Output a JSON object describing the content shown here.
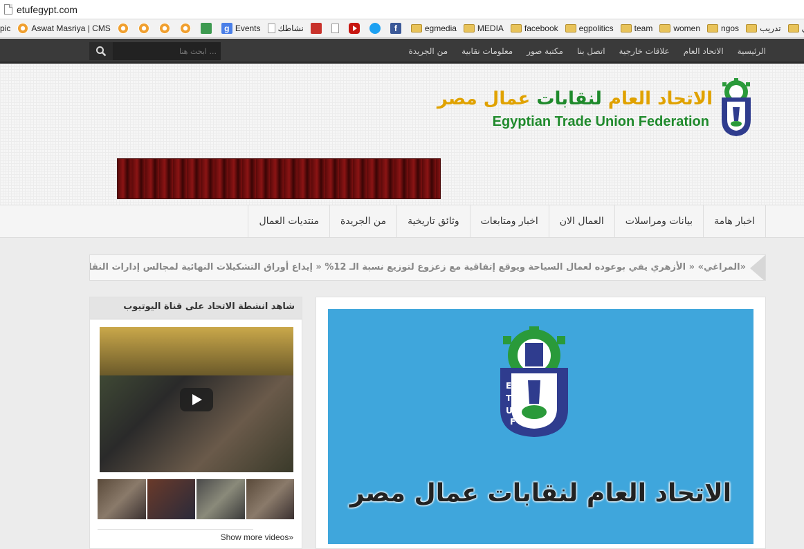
{
  "browser": {
    "url": "etufegypt.com",
    "bookmarks": [
      {
        "label": "pic",
        "icon": "none"
      },
      {
        "label": "Aswat Masriya | CMS",
        "icon": "orange-icon"
      },
      {
        "label": "",
        "icon": "orange-icon"
      },
      {
        "label": "",
        "icon": "orange-icon"
      },
      {
        "label": "",
        "icon": "orange-icon"
      },
      {
        "label": "",
        "icon": "orange-icon"
      },
      {
        "label": "",
        "icon": "tree-icon"
      },
      {
        "label": "Events",
        "icon": "google-icon"
      },
      {
        "label": "نشاطك",
        "icon": "page-icon"
      },
      {
        "label": "",
        "icon": "red-icon"
      },
      {
        "label": "",
        "icon": "page-icon"
      },
      {
        "label": "",
        "icon": "youtube-icon"
      },
      {
        "label": "",
        "icon": "twitter-icon"
      },
      {
        "label": "",
        "icon": "facebook-icon"
      },
      {
        "label": "egmedia",
        "icon": "folder-icon"
      },
      {
        "label": "MEDIA",
        "icon": "folder-icon"
      },
      {
        "label": "facebook",
        "icon": "folder-icon"
      },
      {
        "label": "egpolitics",
        "icon": "folder-icon"
      },
      {
        "label": "team",
        "icon": "folder-icon"
      },
      {
        "label": "women",
        "icon": "folder-icon"
      },
      {
        "label": "ngos",
        "icon": "folder-icon"
      },
      {
        "label": "تدريب",
        "icon": "folder-icon"
      },
      {
        "label": "ثقافي",
        "icon": "folder-icon"
      }
    ]
  },
  "topnav": {
    "links": [
      "الرئيسية",
      "الاتحاد العام",
      "علاقات خارجية",
      "اتصل بنا",
      "مكتبة صور",
      "معلومات نقابية",
      "من الجريدة"
    ],
    "search_placeholder": "ابحث هنا ..."
  },
  "header": {
    "logo_ar_part1": "الاتحاد العام ",
    "logo_ar_part2": "لنقابات",
    "logo_ar_part3": " عمال مصر",
    "logo_en": "Egyptian Trade Union Federation"
  },
  "mainnav": {
    "items": [
      "اخبار هامة",
      "بيانات ومراسلات",
      "العمال الان",
      "اخبار ومتابعات",
      "وثائق تاريخية",
      "من الجريدة",
      "منتديات العمال"
    ]
  },
  "ticker": {
    "text": "«المراغي»  «  الأزهري يفي بوعوده لعمال السياحة ويوقع إتفاقية مع زعزوع لتوزيع نسبة الـ 12%  «  إيداع أوراق التشكيلات النهائية لمجالس إدارات النقابات العامة التابعة"
  },
  "feature": {
    "title": "الاتحاد العام لنقابات عمال مصر",
    "accent_color": "#3fa6dc"
  },
  "sidebar": {
    "heading": "شاهد انشطة الاتحاد على قناة اليوتيوب",
    "show_more": "Show more videos»"
  }
}
